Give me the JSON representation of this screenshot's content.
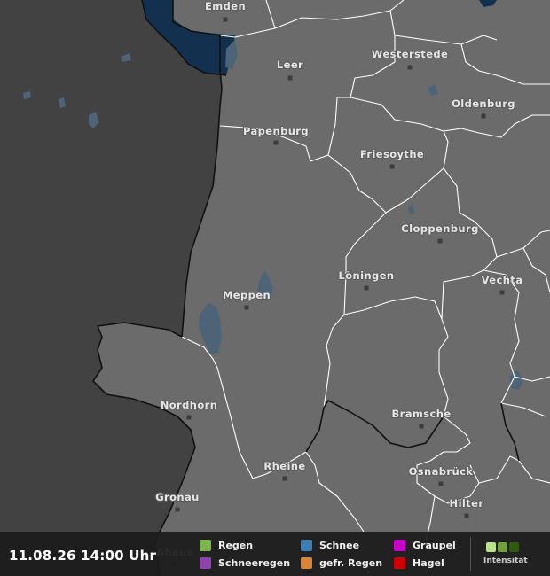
{
  "map": {
    "cities": [
      {
        "name": "Emden"
      },
      {
        "name": "Leer"
      },
      {
        "name": "Westerstede"
      },
      {
        "name": "Oldenburg"
      },
      {
        "name": "Papenburg"
      },
      {
        "name": "Friesoythe"
      },
      {
        "name": "Cloppenburg"
      },
      {
        "name": "Meppen"
      },
      {
        "name": "Löningen"
      },
      {
        "name": "Vechta"
      },
      {
        "name": "Nordhorn"
      },
      {
        "name": "Bramsche"
      },
      {
        "name": "Rheine"
      },
      {
        "name": "Osnabrück"
      },
      {
        "name": "Gronau"
      },
      {
        "name": "Ahaus"
      },
      {
        "name": "Hilter"
      }
    ],
    "colors": {
      "background": "#3a3a3a",
      "land": "#6b6b6b",
      "foreign_land": "#424242",
      "sea": "#13314e",
      "inland_water": "#4d6478",
      "inner_border": "#ffffff",
      "outer_border": "#111111"
    }
  },
  "legend": {
    "timestamp": "11.08.26 14:00 Uhr",
    "items": [
      {
        "label": "Regen",
        "color": "#7ab648"
      },
      {
        "label": "Schneeregen",
        "color": "#8e44ad"
      },
      {
        "label": "Schnee",
        "color": "#3d7eb3"
      },
      {
        "label": "gefr. Regen",
        "color": "#d9843b"
      },
      {
        "label": "Graupel",
        "color": "#cc00cc"
      },
      {
        "label": "Hagel",
        "color": "#d10000"
      }
    ],
    "intensity": {
      "label": "Intensität",
      "colors": [
        "#b9e38a",
        "#6fa33a",
        "#2f5a0f"
      ]
    }
  }
}
